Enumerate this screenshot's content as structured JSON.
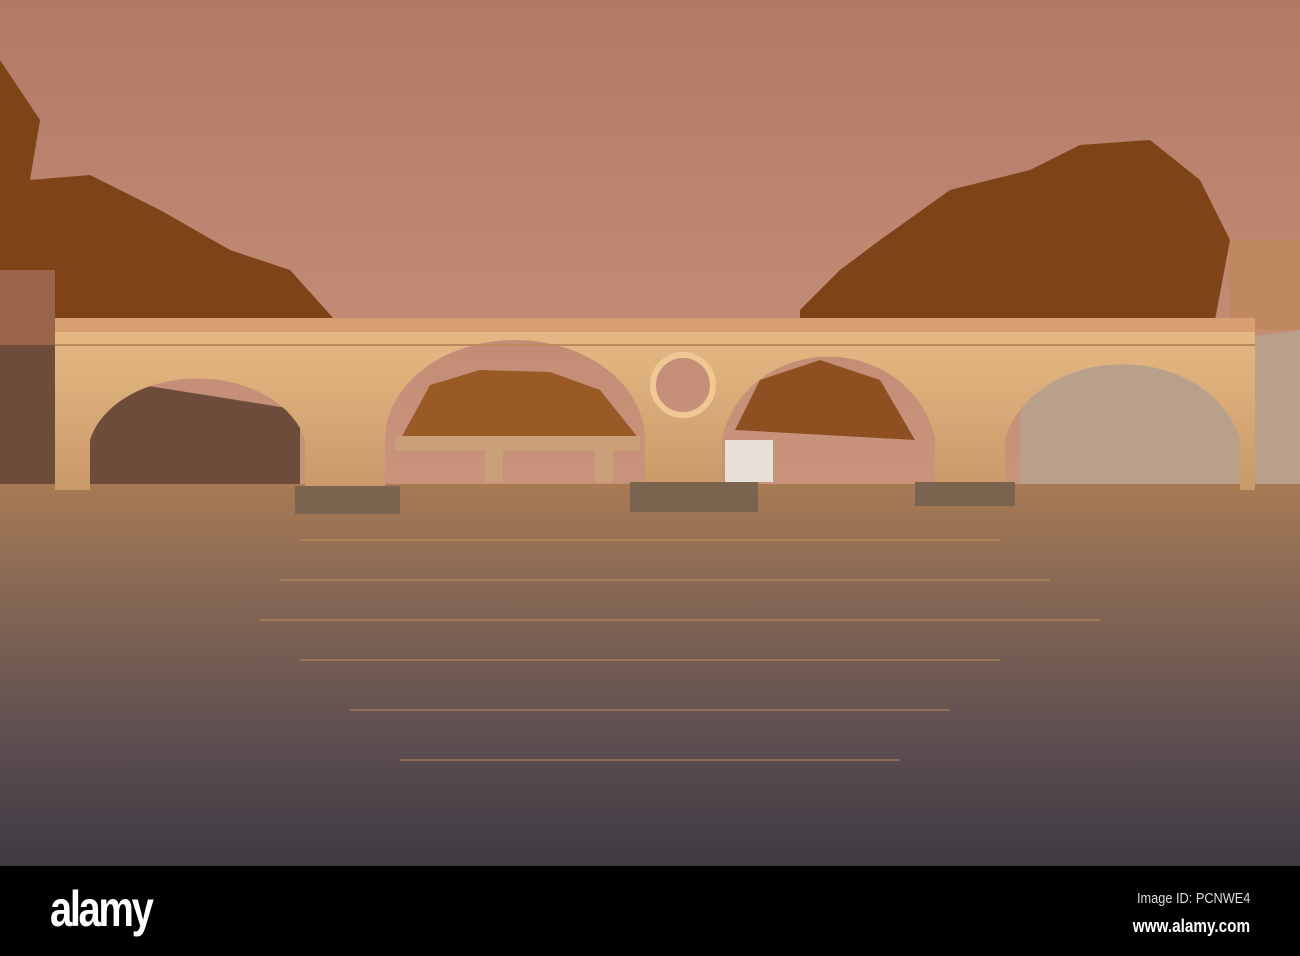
{
  "photo": {
    "colors": {
      "sky": "#c48a6e",
      "trees": "#8a4a1e",
      "stone": "#e2b07a",
      "water": "#5e5050"
    }
  },
  "footer": {
    "logo": "alamy",
    "image_id": "Image ID: PCNWE4",
    "website": "www.alamy.com"
  }
}
